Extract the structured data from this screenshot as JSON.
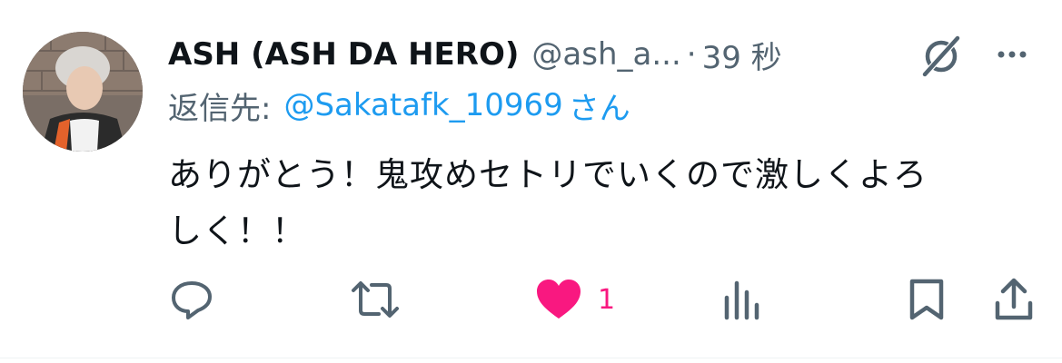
{
  "tweet": {
    "display_name": "ASH (ASH DA HERO)",
    "handle": "@ash_a...",
    "separator": "·",
    "time": "39 秒",
    "reply_label": "返信先:",
    "reply_handle": "@Sakatafk_10969",
    "reply_suffix": "さん",
    "text_line1": "ありがとう！鬼攻めセトリでいくので激しくよろ",
    "text_line2": "しく！！"
  },
  "actions": {
    "reply_icon": "reply-bubble-icon",
    "retweet_icon": "retweet-icon",
    "like_icon": "heart-filled-icon",
    "like_count": "1",
    "views_icon": "bar-chart-icon",
    "bookmark_icon": "bookmark-icon",
    "share_icon": "share-icon"
  },
  "colors": {
    "text_primary": "#0f1419",
    "text_secondary": "#536471",
    "link": "#1d9bf0",
    "like": "#f91880",
    "icon": "#536471"
  }
}
